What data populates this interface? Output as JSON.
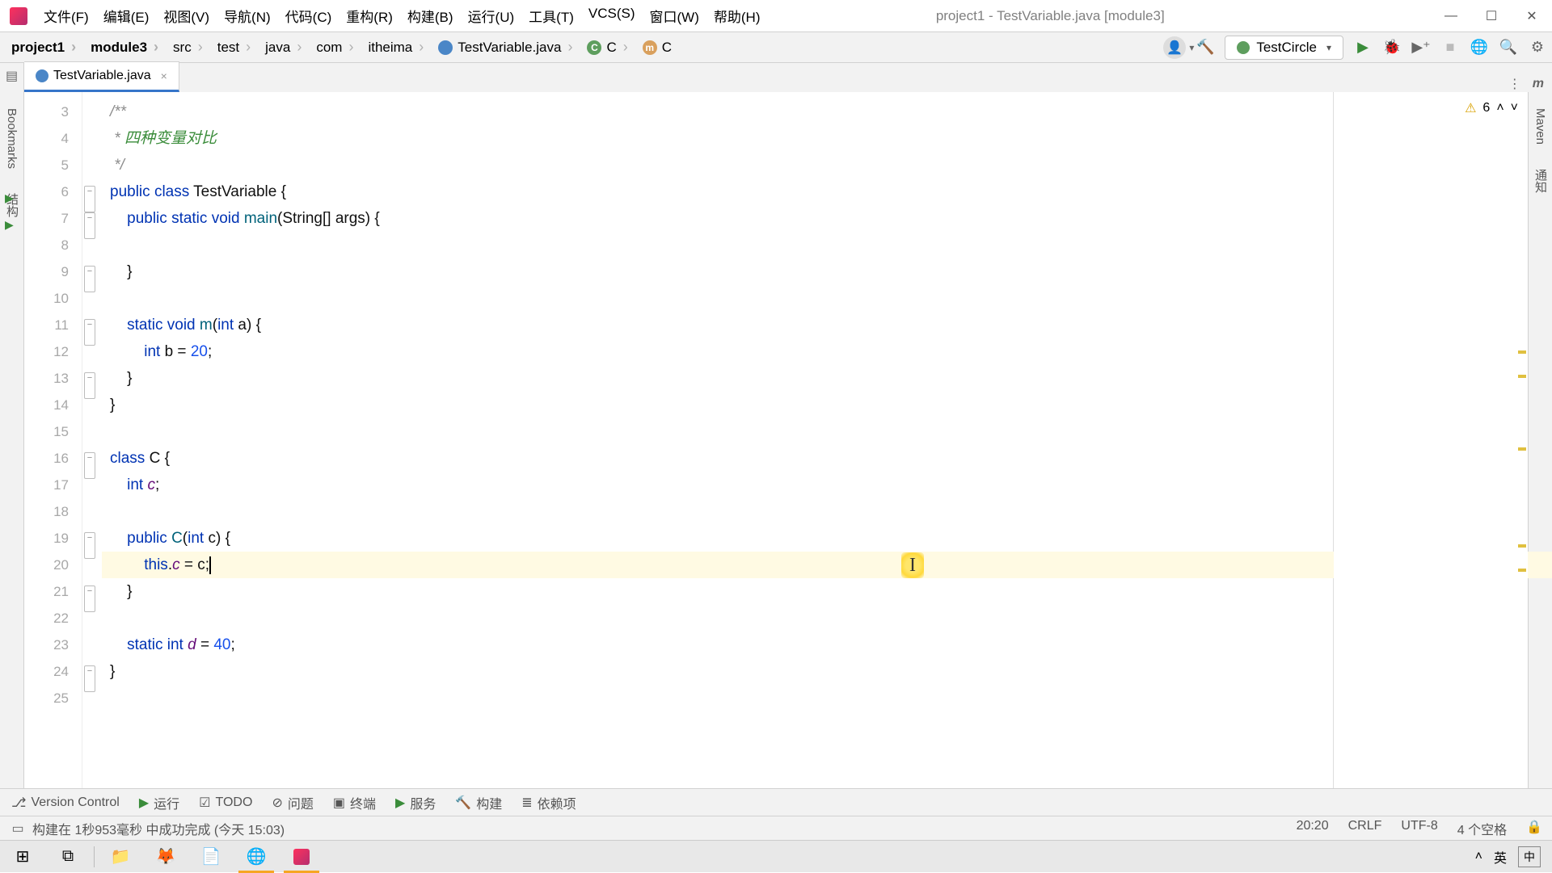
{
  "window": {
    "title": "project1 - TestVariable.java [module3]"
  },
  "menus": [
    "文件(F)",
    "编辑(E)",
    "视图(V)",
    "导航(N)",
    "代码(C)",
    "重构(R)",
    "构建(B)",
    "运行(U)",
    "工具(T)",
    "VCS(S)",
    "窗口(W)",
    "帮助(H)"
  ],
  "breadcrumbs": {
    "items": [
      {
        "label": "project1",
        "bold": true
      },
      {
        "label": "module3",
        "bold": true
      },
      {
        "label": "src"
      },
      {
        "label": "test"
      },
      {
        "label": "java"
      },
      {
        "label": "com"
      },
      {
        "label": "itheima"
      },
      {
        "label": "TestVariable.java",
        "icon": "java"
      },
      {
        "label": "C",
        "icon": "class"
      },
      {
        "label": "C",
        "icon": "method"
      }
    ]
  },
  "run_config": "TestCircle",
  "tab": {
    "name": "TestVariable.java"
  },
  "inspection": {
    "warn_count": "6"
  },
  "code": {
    "lines": [
      {
        "n": "3",
        "html": "<span class='cm'>/**</span>"
      },
      {
        "n": "4",
        "html": "<span class='cm'> * </span><span class='cmzh'>四种变量对比</span>"
      },
      {
        "n": "5",
        "html": "<span class='cm'> */</span>"
      },
      {
        "n": "6",
        "html": "<span class='kw'>public</span> <span class='kw'>class</span> TestVariable {",
        "run": true,
        "fold": "-"
      },
      {
        "n": "7",
        "html": "    <span class='kw'>public</span> <span class='kw'>static</span> <span class='kw'>void</span> <span class='fn'>main</span>(String[] args) {",
        "run": true,
        "fold": "-"
      },
      {
        "n": "8",
        "html": ""
      },
      {
        "n": "9",
        "html": "    }",
        "fold": "-"
      },
      {
        "n": "10",
        "html": ""
      },
      {
        "n": "11",
        "html": "    <span class='kw'>static</span> <span class='kw'>void</span> <span class='fn'>m</span>(<span class='kw'>int</span> a) {",
        "fold": "-"
      },
      {
        "n": "12",
        "html": "        <span class='kw'>int</span> b = <span class='num'>20</span>;"
      },
      {
        "n": "13",
        "html": "    }",
        "fold": "-"
      },
      {
        "n": "14",
        "html": "}"
      },
      {
        "n": "15",
        "html": ""
      },
      {
        "n": "16",
        "html": "<span class='kw'>class</span> C {",
        "fold": "-"
      },
      {
        "n": "17",
        "html": "    <span class='kw'>int</span> <span class='var'>c</span>;"
      },
      {
        "n": "18",
        "html": ""
      },
      {
        "n": "19",
        "html": "    <span class='kw'>public</span> <span class='fn'>C</span>(<span class='kw'>int</span> c) {",
        "fold": "-"
      },
      {
        "n": "20",
        "html": "        <span class='kw'>this</span>.<span class='var'>c</span> = c;<span class='caret'></span>",
        "hl": true
      },
      {
        "n": "21",
        "html": "    }",
        "fold": "-"
      },
      {
        "n": "22",
        "html": ""
      },
      {
        "n": "23",
        "html": "    <span class='kw'>static</span> <span class='kw'>int</span> <span class='var'>d</span> = <span class='num'>40</span>;"
      },
      {
        "n": "24",
        "html": "}",
        "fold": "-"
      },
      {
        "n": "25",
        "html": ""
      }
    ]
  },
  "left_tools": [
    "Bookmarks",
    "结构"
  ],
  "right_tools": [
    "Maven",
    "通知"
  ],
  "bottom_tools": [
    {
      "icon": "⎇",
      "label": "Version Control"
    },
    {
      "icon": "▶",
      "label": "运行",
      "cls": "play"
    },
    {
      "icon": "☑",
      "label": "TODO"
    },
    {
      "icon": "⊘",
      "label": "问题"
    },
    {
      "icon": "▣",
      "label": "终端"
    },
    {
      "icon": "▶",
      "label": "服务",
      "cls": "play"
    },
    {
      "icon": "🔨",
      "label": "构建"
    },
    {
      "icon": "≣",
      "label": "依赖项"
    }
  ],
  "status": {
    "msg": "构建在 1秒953毫秒 中成功完成 (今天 15:03)",
    "pos": "20:20",
    "eol": "CRLF",
    "enc": "UTF-8",
    "indent": "4 个空格"
  },
  "ime": {
    "lang": "英",
    "mode": "中"
  }
}
